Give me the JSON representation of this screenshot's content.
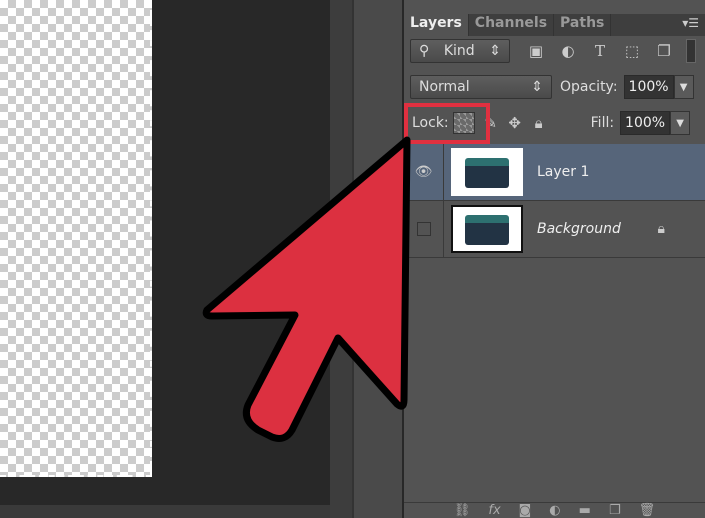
{
  "layers_panel": {
    "tabs": [
      "Layers",
      "Channels",
      "Paths"
    ],
    "active_tab": "Layers",
    "filter_kind": "Kind",
    "blend_mode": "Normal",
    "opacity_label": "Opacity:",
    "opacity": "100%",
    "lock_label": "Lock:",
    "fill_label": "Fill:",
    "fill": "100%",
    "layers": [
      {
        "name": "Layer 1",
        "visible": true,
        "selected": true
      },
      {
        "name": "Background",
        "visible": false,
        "locked": true
      }
    ]
  },
  "colors": {
    "highlight": "#e03040",
    "arrow": "#dc3040",
    "selected_layer": "#56657a"
  }
}
